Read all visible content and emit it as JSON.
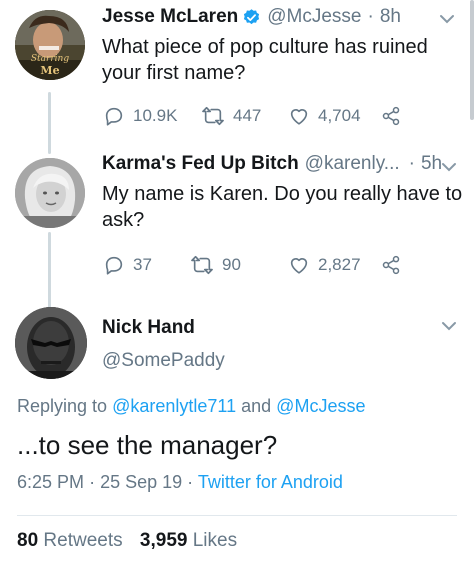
{
  "tweets": [
    {
      "name": "Jesse McLaren",
      "verified": true,
      "handle": "@McJesse",
      "separator": "·",
      "time": "8h",
      "text_line1": "What piece of pop culture has ruined",
      "text_line2": "your first name?",
      "avatar_caption_top": "Starring",
      "avatar_caption_bottom": "Me",
      "replies": "10.9K",
      "retweets": "447",
      "likes": "4,704"
    },
    {
      "name": "Karma's Fed Up Bitch",
      "handle": "@karenly...",
      "separator": "·",
      "time": "5h",
      "text_line1": "My name is Karen. Do you really have to",
      "text_line2": "ask?",
      "replies": "37",
      "retweets": "90",
      "likes": "2,827"
    }
  ],
  "main_tweet": {
    "name": "Nick Hand",
    "handle": "@SomePaddy",
    "replying_prefix": "Replying to",
    "replying_user1": "@karenlytle711",
    "replying_and": "and",
    "replying_user2": "@McJesse",
    "text": "...to see the manager?",
    "time": "6:25 PM",
    "dot1": "·",
    "date": "25 Sep 19",
    "dot2": "·",
    "client": "Twitter for Android",
    "retweet_count": "80",
    "retweet_label": "Retweets",
    "like_count": "3,959",
    "like_label": "Likes"
  },
  "colors": {
    "accent": "#1da1f2",
    "secondary_text": "#657786",
    "thread_line": "#cfd9de"
  },
  "icons": [
    "verified-badge-icon",
    "chevron-down-icon",
    "reply-icon",
    "retweet-icon",
    "like-icon",
    "share-icon"
  ]
}
